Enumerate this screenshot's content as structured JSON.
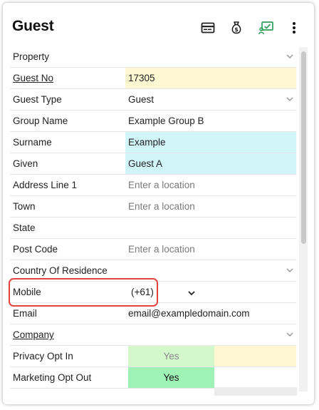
{
  "header": {
    "title": "Guest",
    "icons": [
      "card-icon",
      "money-bag-icon",
      "presentation-check-icon",
      "more-vert-icon"
    ],
    "accent_icon_color": "#2e9e5b"
  },
  "fields": {
    "property": {
      "label": "Property",
      "value": ""
    },
    "guest_no": {
      "label": "Guest No",
      "value": "17305"
    },
    "guest_type": {
      "label": "Guest Type",
      "value": "Guest"
    },
    "group_name": {
      "label": "Group Name",
      "value": "Example Group B"
    },
    "surname": {
      "label": "Surname",
      "value": "Example"
    },
    "given": {
      "label": "Given",
      "value": "Guest A"
    },
    "address_line_1": {
      "label": "Address Line 1",
      "placeholder": "Enter a location"
    },
    "town": {
      "label": "Town",
      "placeholder": "Enter a location"
    },
    "state": {
      "label": "State",
      "value": ""
    },
    "post_code": {
      "label": "Post Code",
      "placeholder": "Enter a location"
    },
    "country_of_residence": {
      "label": "Country Of Residence",
      "value": ""
    },
    "mobile": {
      "label": "Mobile",
      "code": "(+61)"
    },
    "email": {
      "label": "Email",
      "value": "email@exampledomain.com"
    },
    "company": {
      "label": "Company",
      "value": ""
    },
    "privacy_opt_in": {
      "label": "Privacy Opt In",
      "value": "Yes"
    },
    "marketing_opt_out": {
      "label": "Marketing Opt Out",
      "value": "Yes"
    }
  },
  "colors": {
    "yellow_field": "#fdf8d2",
    "cyan_field": "#d2f5fa",
    "yes_light": "#d4f8cc",
    "yes_strong": "#9ef2b5",
    "highlight_border": "#e3443f"
  }
}
